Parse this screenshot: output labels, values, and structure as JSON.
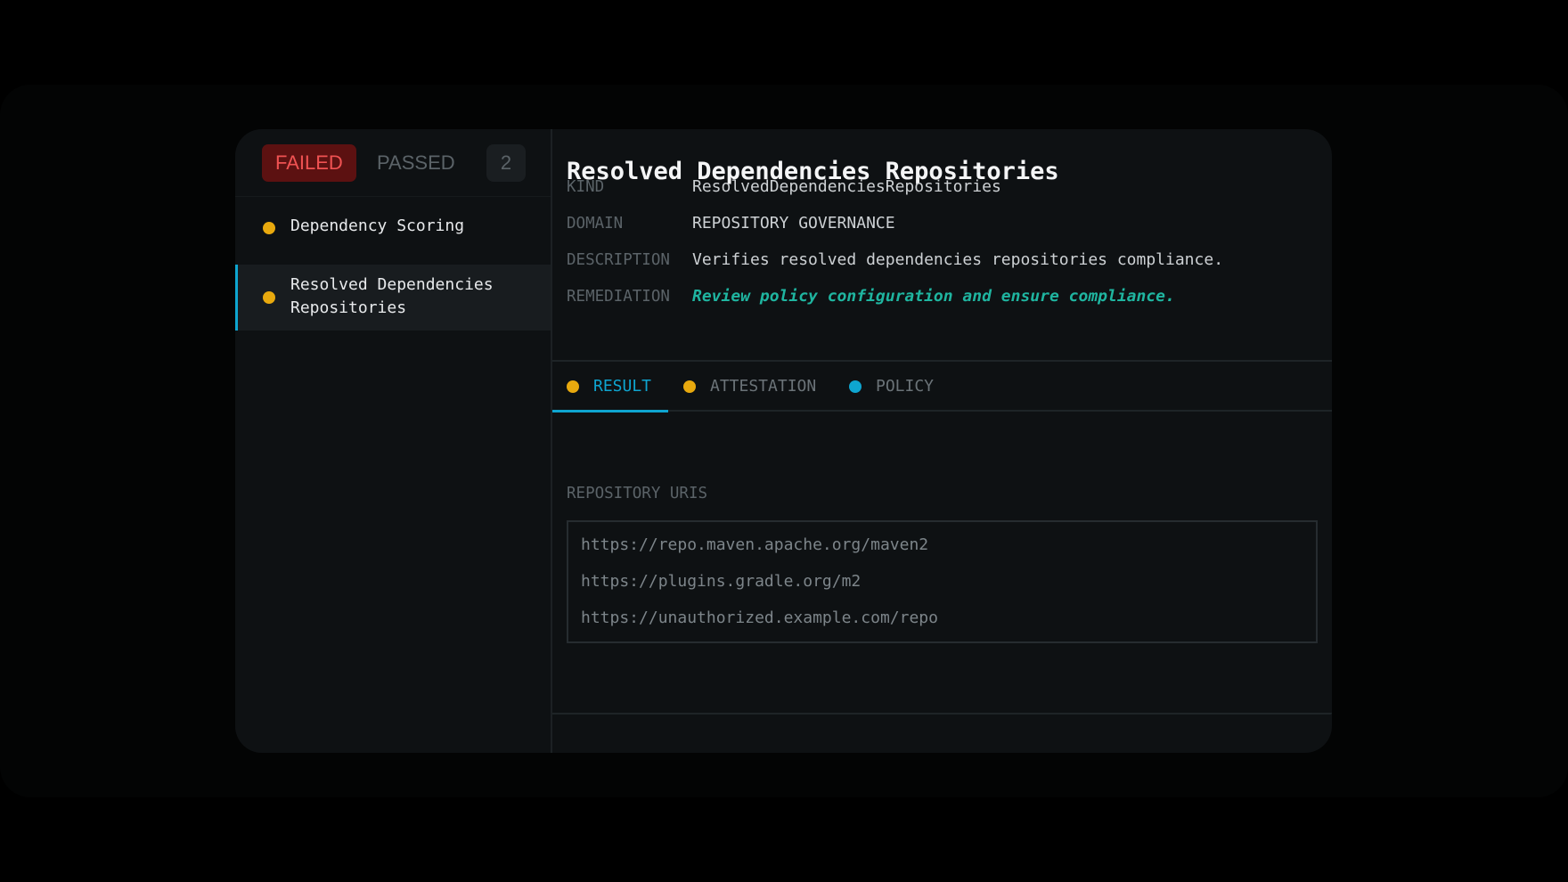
{
  "sidebar": {
    "filters": {
      "failed_label": "FAILED",
      "passed_label": "PASSED",
      "count": "2"
    },
    "items": [
      {
        "label": "Dependency Scoring",
        "status_color": "#e8a90e",
        "selected": false
      },
      {
        "label": "Resolved Dependencies Repositories",
        "status_color": "#e8a90e",
        "selected": true
      }
    ]
  },
  "detail": {
    "title": "Resolved Dependencies Repositories",
    "meta": {
      "kind_key": "KIND",
      "kind_value": "ResolvedDependenciesRepositories",
      "domain_key": "DOMAIN",
      "domain_value": "REPOSITORY GOVERNANCE",
      "description_key": "DESCRIPTION",
      "description_value": "Verifies resolved dependencies repositories compliance.",
      "remediation_key": "REMEDIATION",
      "remediation_value": "Review policy configuration and ensure compliance."
    },
    "tabs": [
      {
        "label": "RESULT",
        "status_color": "#e8a90e",
        "active": true
      },
      {
        "label": "ATTESTATION",
        "status_color": "#e8a90e",
        "active": false
      },
      {
        "label": "POLICY",
        "status_color": "#0ea5d0",
        "active": false
      }
    ],
    "result": {
      "section_label": "REPOSITORY URIS",
      "uris": [
        "https://repo.maven.apache.org/maven2",
        "https://plugins.gradle.org/m2",
        "https://unauthorized.example.com/repo"
      ]
    }
  },
  "colors": {
    "accent": "#0ea5d0",
    "warning": "#e8a90e",
    "failed": "#f05252",
    "remediation": "#1fb5a0"
  }
}
